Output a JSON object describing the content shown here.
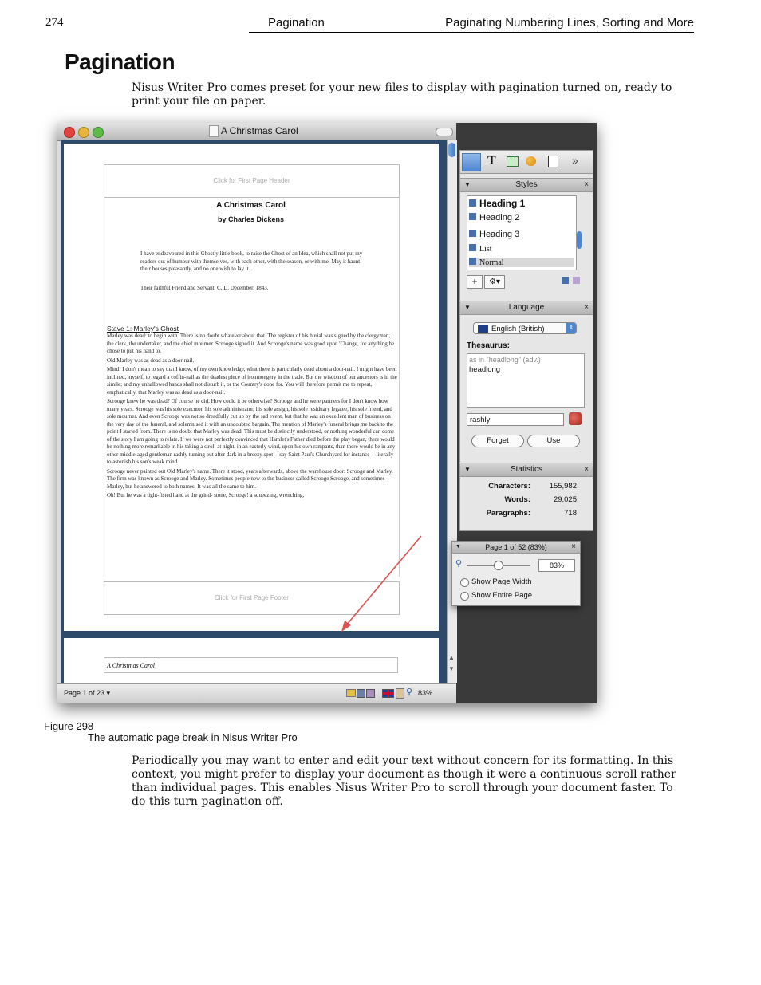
{
  "header": {
    "page_number": "274",
    "section": "Pagination",
    "chapter": "Paginating Numbering Lines, Sorting and More"
  },
  "title": "Pagination",
  "intro": "Nisus Writer Pro comes preset for your new files to display with pagination turned on, ready to print your file on paper.",
  "screenshot": {
    "window_title": "A Christmas Carol",
    "page": {
      "header_placeholder": "Click for First Page Header",
      "book_title": "A Christmas Carol",
      "author": "by Charles Dickens",
      "preface": "I have endeavoured in this Ghostly little book, to raise the Ghost of an Idea, which shall not put my readers out of humour with themselves, with each other, with the season, or with me. May it haunt their houses pleasantly, and no one wish to lay it.",
      "signature": "Their faithful Friend and Servant, C. D. December, 1843.",
      "stave_heading": "Stave 1: Marley's Ghost",
      "paragraphs": [
        "Marley was dead: to begin with. There is no doubt whatever about that. The register of his burial was signed by the clergyman, the clerk, the undertaker, and the chief mourner. Scrooge signed it. And Scrooge's name was good upon 'Change, for anything he chose to put his hand to.",
        "Old Marley was as dead as a door-nail.",
        "Mind! I don't mean to say that I know, of my own knowledge, what there is particularly dead about a door-nail. I might have been inclined, myself, to regard a coffin-nail as the deadest piece of ironmongery in the trade. But the wisdom of our ancestors is in the simile; and my unhallowed hands shall not disturb it, or the Country's done for. You will therefore permit me to repeat, emphatically, that Marley was as dead as a door-nail.",
        "Scrooge knew he was dead? Of course he did. How could it be otherwise? Scrooge and he were partners for I don't know how many years. Scrooge was his sole executor, his sole administrator, his sole assign, his sole residuary legatee, his sole friend, and sole mourner. And even Scrooge was not so dreadfully cut up by the sad event, but that he was an excellent man of business on the very day of the funeral, and solemnised it with an undoubted bargain. The mention of Marley's funeral brings me back to the point I started from. There is no doubt that Marley was dead. This must be distinctly understood, or nothing wonderful can come of the story I am going to relate. If we were not perfectly convinced that Hamlet's Father died before the play began, there would be nothing more remarkable in his taking a stroll at night, in an easterly wind, upon his own ramparts, than there would be in any other middle-aged gentleman rashly turning out after dark in a breezy spot -- say Saint Paul's Churchyard for instance -- literally to astonish his son's weak mind.",
        "Scrooge never painted out Old Marley's name. There it stood, years afterwards, above the warehouse door: Scrooge and Marley. The firm was known as Scrooge and Marley. Sometimes people new to the business called Scrooge Scrooge, and sometimes Marley, but he answered to both names. It was all the same to him.",
        "Oh! But he was a tight-fisted hand at the grind- stone, Scrooge! a squeezing, wrenching,"
      ],
      "footer_placeholder": "Click for First Page Footer",
      "next_page_header": "A Christmas Carol"
    },
    "statusbar": {
      "page_indicator": "Page 1 of 23 ▾",
      "zoom": "83%"
    },
    "styles_panel": {
      "title": "Styles",
      "items": [
        "Heading 1",
        "Heading 2",
        "Heading 3",
        "List",
        "Normal"
      ]
    },
    "language_panel": {
      "title": "Language",
      "language": "English (British)",
      "thesaurus_label": "Thesaurus:",
      "thesaurus_hint": "as in \"headlong\" (adv.)",
      "thesaurus_result": "headlong",
      "word": "rashly",
      "forget_label": "Forget",
      "use_label": "Use"
    },
    "statistics_panel": {
      "title": "Statistics",
      "rows": [
        {
          "label": "Characters:",
          "value": "155,982"
        },
        {
          "label": "Words:",
          "value": "29,025"
        },
        {
          "label": "Paragraphs:",
          "value": "718"
        }
      ]
    },
    "page_panel": {
      "title": "Page 1 of 52 (83%)",
      "zoom_value": "83%",
      "option_page_width": "Show Page Width",
      "option_entire_page": "Show Entire Page"
    }
  },
  "figure": {
    "number": "Figure 298",
    "caption": "The automatic page break in Nisus Writer Pro"
  },
  "body_paragraph": "Periodically you may want to enter and edit your text without concern for its formatting. In this context, you might prefer to display your document as though it were a continuous scroll rather than individual pages. This enables Nisus Writer Pro to scroll through your document faster. To do this turn pagination off."
}
